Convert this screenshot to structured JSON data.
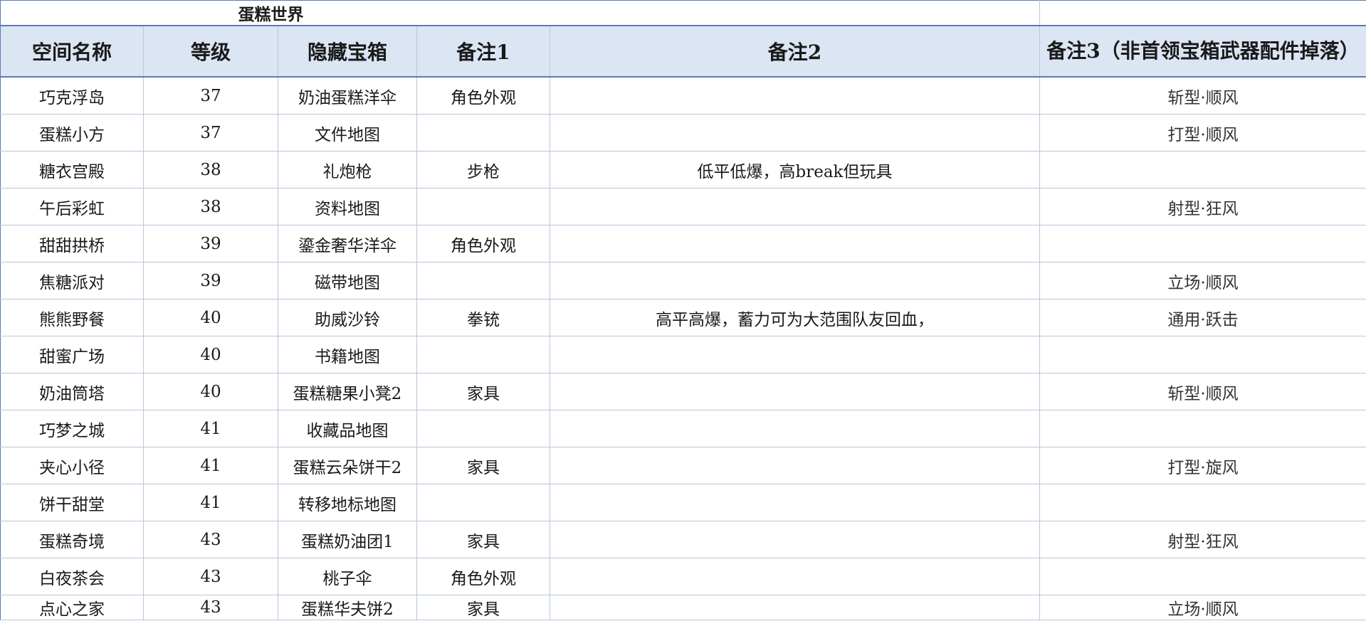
{
  "sheet": {
    "title": "蛋糕世界",
    "headers": [
      "空间名称",
      "等级",
      "隐藏宝箱",
      "备注1",
      "备注2",
      "备注3（非首领宝箱武器配件掉落）"
    ],
    "rows": [
      {
        "name": "巧克浮岛",
        "level": "37",
        "chest": "奶油蛋糕洋伞",
        "note1": "角色外观",
        "note2": "",
        "note3": "斩型·顺风"
      },
      {
        "name": "蛋糕小方",
        "level": "37",
        "chest": "文件地图",
        "note1": "",
        "note2": "",
        "note3": "打型·顺风"
      },
      {
        "name": "糖衣宫殿",
        "level": "38",
        "chest": "礼炮枪",
        "note1": "步枪",
        "note2": "低平低爆，高break但玩具",
        "note3": ""
      },
      {
        "name": "午后彩虹",
        "level": "38",
        "chest": "资料地图",
        "note1": "",
        "note2": "",
        "note3": "射型·狂风"
      },
      {
        "name": "甜甜拱桥",
        "level": "39",
        "chest": "鎏金奢华洋伞",
        "note1": "角色外观",
        "note2": "",
        "note3": ""
      },
      {
        "name": "焦糖派对",
        "level": "39",
        "chest": "磁带地图",
        "note1": "",
        "note2": "",
        "note3": "立场·顺风"
      },
      {
        "name": "熊熊野餐",
        "level": "40",
        "chest": "助威沙铃",
        "note1": "拳铳",
        "note2": "高平高爆，蓄力可为大范围队友回血，",
        "note3": "通用·跃击"
      },
      {
        "name": "甜蜜广场",
        "level": "40",
        "chest": "书籍地图",
        "note1": "",
        "note2": "",
        "note3": ""
      },
      {
        "name": "奶油筒塔",
        "level": "40",
        "chest": "蛋糕糖果小凳2",
        "note1": "家具",
        "note2": "",
        "note3": "斩型·顺风"
      },
      {
        "name": "巧梦之城",
        "level": "41",
        "chest": "收藏品地图",
        "note1": "",
        "note2": "",
        "note3": ""
      },
      {
        "name": "夹心小径",
        "level": "41",
        "chest": "蛋糕云朵饼干2",
        "note1": "家具",
        "note2": "",
        "note3": "打型·旋风"
      },
      {
        "name": "饼干甜堂",
        "level": "41",
        "chest": "转移地标地图",
        "note1": "",
        "note2": "",
        "note3": ""
      },
      {
        "name": "蛋糕奇境",
        "level": "43",
        "chest": "蛋糕奶油团1",
        "note1": "家具",
        "note2": "",
        "note3": "射型·狂风"
      },
      {
        "name": "白夜茶会",
        "level": "43",
        "chest": "桃子伞",
        "note1": "角色外观",
        "note2": "",
        "note3": ""
      },
      {
        "name": "点心之家",
        "level": "43",
        "chest": "蛋糕华夫饼2",
        "note1": "家具",
        "note2": "",
        "note3": "立场·顺风"
      }
    ]
  }
}
